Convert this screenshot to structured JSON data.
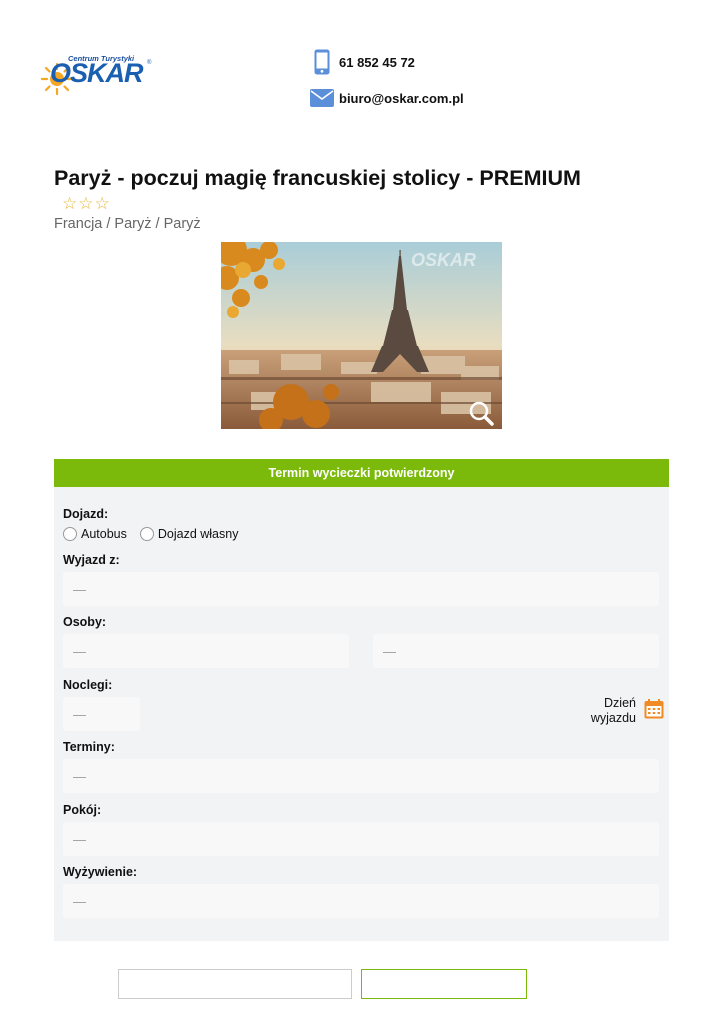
{
  "logo": {
    "small_text": "Centrum Turystyki",
    "brand": "OSKAR",
    "reg": "®"
  },
  "contact": {
    "phone": "61 852 45 72",
    "email": "biuro@oskar.com.pl"
  },
  "icons": {
    "phone": "phone-icon",
    "email": "envelope-icon",
    "calendar": "calendar-icon",
    "zoom": "magnifier-icon",
    "star": "star-outline-icon"
  },
  "colors": {
    "accent_green": "#7bba0b",
    "brand_blue": "#1b5fb0",
    "star_gold": "#e7b53a",
    "calendar_orange": "#f08a24"
  },
  "tour": {
    "title": "Paryż - poczuj magię francuskiej stolicy - PREMIUM",
    "stars": "☆☆☆",
    "breadcrumb": "Francja / Paryż / Paryż",
    "image_watermark": "OSKAR"
  },
  "form": {
    "header": "Termin wycieczki potwierdzony",
    "dojazd_label": "Dojazd:",
    "dojazd_options": [
      "Autobus",
      "Dojazd własny"
    ],
    "wyjazd_label": "Wyjazd z:",
    "wyjazd_value": "—",
    "osoby_label": "Osoby:",
    "osoby_value_1": "—",
    "osoby_value_2": "—",
    "noclegi_label": "Noclegi:",
    "noclegi_value": "—",
    "dzien_wyjazdu_line1": "Dzień",
    "dzien_wyjazdu_line2": "wyjazdu",
    "terminy_label": "Terminy:",
    "terminy_value": "—",
    "pokoj_label": "Pokój:",
    "pokoj_value": "—",
    "wyzywienie_label": "Wyżywienie:",
    "wyzywienie_value": "—"
  }
}
